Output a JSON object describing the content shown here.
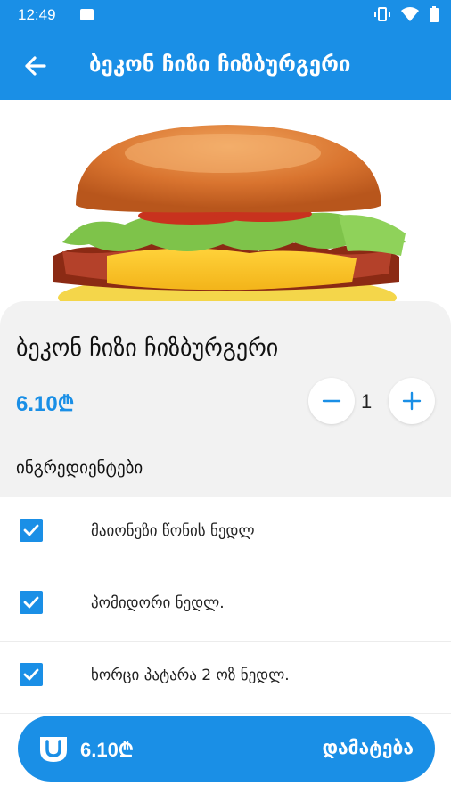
{
  "status": {
    "time": "12:49"
  },
  "header": {
    "title": "ბეკონ ჩიზი ჩიზბურგერი"
  },
  "product": {
    "name": "ბეკონ ჩიზი ჩიზბურგერი",
    "price": "6.10₾",
    "quantity": "1"
  },
  "ingredients": {
    "title": "ინგრედიენტები",
    "items": [
      {
        "label": "მაიონეზი წონის ნედლ",
        "checked": true
      },
      {
        "label": "პომიდორი ნედლ.",
        "checked": true
      },
      {
        "label": "ხორცი პატარა 2 ოზ ნედლ.",
        "checked": true
      }
    ]
  },
  "add_button": {
    "price": "6.10₾",
    "label": "დამატება"
  },
  "colors": {
    "accent": "#1a8fe6"
  }
}
